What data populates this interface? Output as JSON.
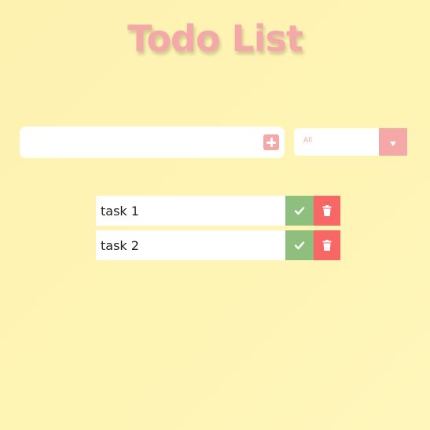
{
  "title": "Todo List",
  "add_form": {
    "input_value": "",
    "add_icon": "plus-square-icon"
  },
  "filter": {
    "selected": "All",
    "arrow_icon": "caret-down-icon"
  },
  "todos": [
    {
      "text": "task 1",
      "complete_icon": "check-icon",
      "delete_icon": "trash-icon"
    },
    {
      "text": "task 2",
      "complete_icon": "check-icon",
      "delete_icon": "trash-icon"
    }
  ],
  "colors": {
    "background": "#fef4b4",
    "accent": "#f5a8a8",
    "complete": "#8fbf7f",
    "delete": "#f86666"
  }
}
